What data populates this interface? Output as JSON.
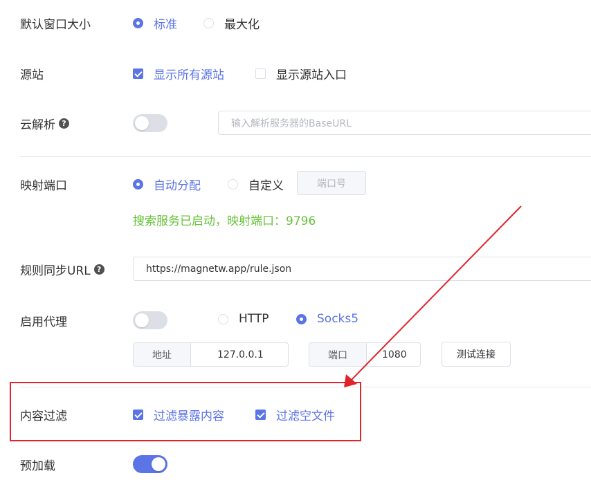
{
  "window_size": {
    "label": "默认窗口大小",
    "options": [
      {
        "label": "标准",
        "selected": true
      },
      {
        "label": "最大化",
        "selected": false
      }
    ]
  },
  "source": {
    "label": "源站",
    "options": [
      {
        "label": "显示所有源站",
        "checked": true
      },
      {
        "label": "显示源站入口",
        "checked": false
      }
    ]
  },
  "cloud_parse": {
    "label": "云解析",
    "help_icon": "question-circle-icon",
    "enabled": false,
    "placeholder": "输入解析服务器的BaseURL"
  },
  "mapping_port": {
    "label": "映射端口",
    "options": [
      {
        "label": "自动分配",
        "selected": true
      },
      {
        "label": "自定义",
        "selected": false
      }
    ],
    "port_placeholder": "端口号",
    "status": "搜索服务已启动，映射端口：9796"
  },
  "rule_sync": {
    "label": "规则同步URL",
    "help_icon": "question-circle-icon",
    "value": "https://magnetw.app/rule.json"
  },
  "proxy": {
    "label": "启用代理",
    "enabled": false,
    "protocols": [
      {
        "label": "HTTP",
        "selected": false
      },
      {
        "label": "Socks5",
        "selected": true
      }
    ],
    "address_label": "地址",
    "address_value": "127.0.0.1",
    "port_label": "端口",
    "port_value": "1080",
    "test_button": "测试连接"
  },
  "content_filter": {
    "label": "内容过滤",
    "options": [
      {
        "label": "过滤暴露内容",
        "checked": true
      },
      {
        "label": "过滤空文件",
        "checked": true
      }
    ]
  },
  "preload": {
    "label": "预加载",
    "enabled": true
  },
  "colors": {
    "accent": "#5b74e6",
    "success": "#67c23a",
    "annotation": "#e0242b"
  }
}
